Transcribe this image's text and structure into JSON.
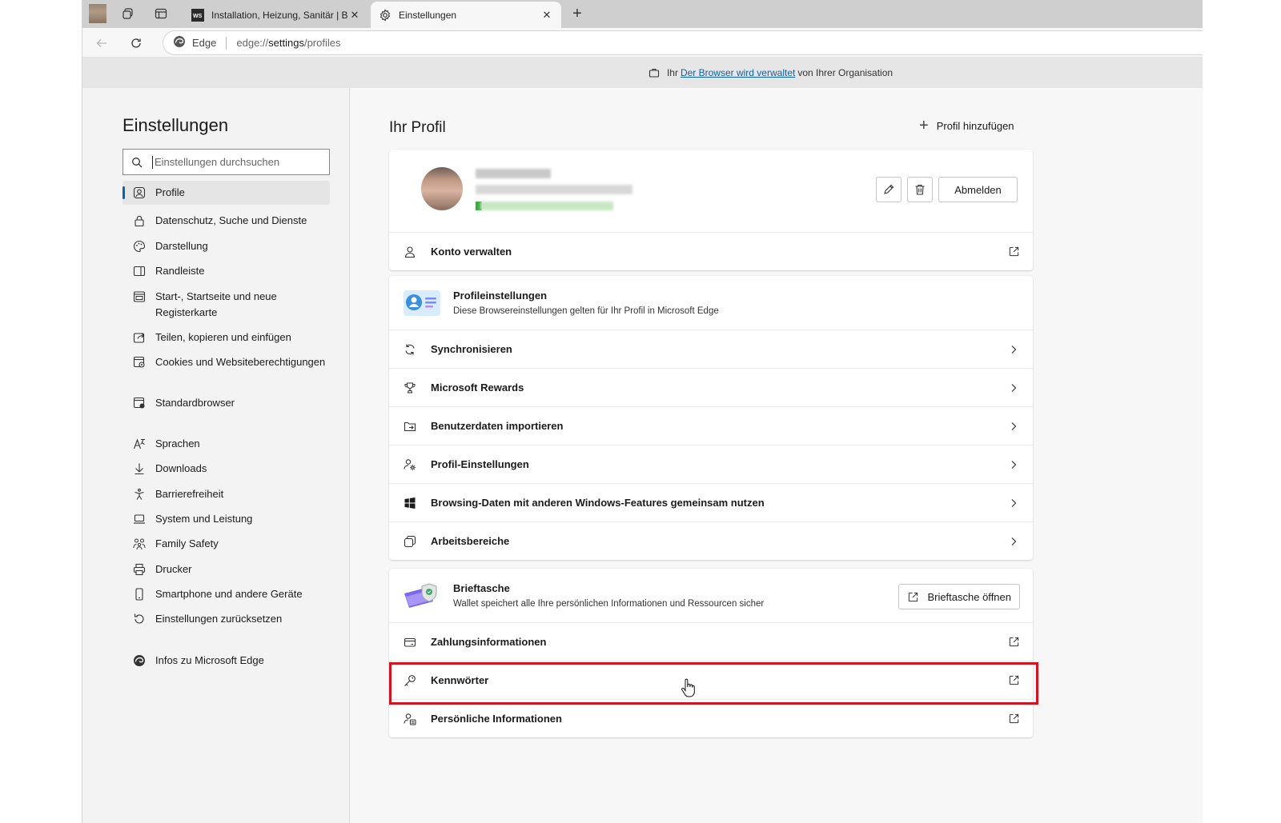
{
  "tabs": [
    {
      "title": "Installation, Heizung, Sanitär | Bac",
      "favicon": "ws-favicon",
      "active": false
    },
    {
      "title": "Einstellungen",
      "favicon": "gear-icon",
      "active": true
    }
  ],
  "address": {
    "brand": "Edge",
    "url_prefix": "edge://",
    "url_bold": "settings",
    "url_suffix": "/profiles"
  },
  "managed_bar": {
    "prefix": "Ihr",
    "link": "Der Browser wird verwaltet",
    "suffix": "von Ihrer Organisation"
  },
  "sidebar": {
    "title": "Einstellungen",
    "search_placeholder": "Einstellungen durchsuchen",
    "items": [
      {
        "label": "Profile",
        "icon": "profile-icon",
        "active": true
      },
      {
        "label": "Datenschutz, Suche und Dienste",
        "icon": "lock-icon"
      },
      {
        "label": "Darstellung",
        "icon": "palette-icon"
      },
      {
        "label": "Randleiste",
        "icon": "sidebar-icon"
      },
      {
        "label": "Start-, Startseite und neue Registerkarte",
        "icon": "home-tab-icon"
      },
      {
        "label": "Teilen, kopieren und einfügen",
        "icon": "share-icon"
      },
      {
        "label": "Cookies und Websiteberechtigungen",
        "icon": "cookies-icon"
      },
      {
        "label": "Standardbrowser",
        "icon": "default-browser-icon"
      },
      {
        "label": "Sprachen",
        "icon": "languages-icon"
      },
      {
        "label": "Downloads",
        "icon": "download-icon"
      },
      {
        "label": "Barrierefreiheit",
        "icon": "accessibility-icon"
      },
      {
        "label": "System und Leistung",
        "icon": "laptop-icon"
      },
      {
        "label": "Family Safety",
        "icon": "family-icon"
      },
      {
        "label": "Drucker",
        "icon": "printer-icon"
      },
      {
        "label": "Smartphone und andere Geräte",
        "icon": "phone-icon"
      },
      {
        "label": "Einstellungen zurücksetzen",
        "icon": "reset-icon"
      },
      {
        "label": "Infos zu Microsoft Edge",
        "icon": "edge-icon"
      }
    ]
  },
  "main": {
    "title": "Ihr Profil",
    "add_profile": "Profil hinzufügen",
    "signout": "Abmelden",
    "manage_account": "Konto verwalten",
    "profile_settings": {
      "title": "Profileinstellungen",
      "subtitle": "Diese Browsereinstellungen gelten für Ihr Profil in Microsoft Edge",
      "rows": [
        {
          "label": "Synchronisieren",
          "icon": "sync-icon"
        },
        {
          "label": "Microsoft Rewards",
          "icon": "trophy-icon"
        },
        {
          "label": "Benutzerdaten importieren",
          "icon": "import-icon"
        },
        {
          "label": "Profil-Einstellungen",
          "icon": "profile-gear-icon"
        },
        {
          "label": "Browsing-Daten mit anderen Windows-Features gemeinsam nutzen",
          "icon": "windows-icon"
        },
        {
          "label": "Arbeitsbereiche",
          "icon": "workspaces-icon"
        }
      ]
    },
    "wallet": {
      "title": "Brieftasche",
      "subtitle": "Wallet speichert alle Ihre persönlichen Informationen und Ressourcen sicher",
      "open_button": "Brieftasche öffnen",
      "rows": [
        {
          "label": "Zahlungsinformationen",
          "icon": "card-icon"
        },
        {
          "label": "Kennwörter",
          "icon": "key-icon"
        },
        {
          "label": "Persönliche Informationen",
          "icon": "personal-info-icon"
        }
      ]
    }
  },
  "colors": {
    "accent": "#0f62a8",
    "highlight": "#d2141e"
  }
}
